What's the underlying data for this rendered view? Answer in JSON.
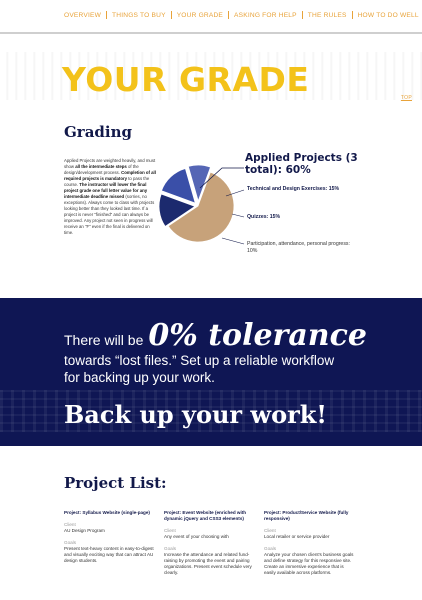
{
  "nav": {
    "items": [
      "OVERVIEW",
      "THINGS TO BUY",
      "YOUR GRADE",
      "ASKING FOR HELP",
      "THE RULES",
      "HOW TO DO WELL"
    ]
  },
  "hero": {
    "title": "YOUR GRADE",
    "top_link": "TOP"
  },
  "grading": {
    "title": "Grading",
    "intro_a": "Applied Projects are weighted heavily, and must show ",
    "intro_b": "all the intermediate steps",
    "intro_c": " of the design/development process. ",
    "intro_d": "Completion of all required projects is mandatory",
    "intro_e": " to pass the course. ",
    "intro_f": "The instructor will lower the final project grade one full letter value for any intermediate deadline missed",
    "intro_g": " (sorries, no exceptions). Always come to class with projects looking better than they looked last time. If a project is never \"finished\" and can always be improved. Any project not seen in progress will receive an \"F\" even if the final is delivered on time.",
    "applied_heading": "Applied Projects (3 total): 60%",
    "legend": [
      "Technical and Design Exercises: 15%",
      "Quizzes: 15%",
      "Participation, attendance, personal progress: 10%"
    ]
  },
  "chart_data": {
    "type": "pie",
    "categories": [
      "Applied Projects (3 total)",
      "Technical and Design Exercises",
      "Quizzes",
      "Participation, attendance, personal progress"
    ],
    "values": [
      60,
      15,
      15,
      10
    ],
    "colors": [
      "#c7a27a",
      "#1c2a6e",
      "#3a4fa8",
      "#5566b5"
    ]
  },
  "banner": {
    "l1_small": "There will be",
    "l1_big": "0% tolerance",
    "l2": "towards “lost files.” Set up a reliable workflow",
    "l3": "for backing up your work.",
    "big": "Back up your work!"
  },
  "project_list": {
    "title": "Project List:",
    "projects": [
      {
        "title": "Project: Syllabus Website (single-page)",
        "client_label": "Client",
        "client": "AU Design Program",
        "goals_label": "Goals",
        "goals": "Present text-heavy content in easy-to-digest and visually exciting way that can attract AU design students."
      },
      {
        "title": "Project: Event Website (enriched with dynamic jQuery and CSS3 elements)",
        "client_label": "Client",
        "client": "Any event of your choosing with",
        "goals_label": "Goals",
        "goals": "Increase the attendance and related fund-raising by promoting the event and pairing organizations. Present event schedule very clearly."
      },
      {
        "title": "Project: Product/Service Website (fully responsive)",
        "client_label": "Client",
        "client": "Local retailer or service provider",
        "goals_label": "Goals",
        "goals": "Analyze your chosen client's business goals and define strategy for this responsive site. Create an immersive experience that is easily available across platforms."
      }
    ]
  }
}
